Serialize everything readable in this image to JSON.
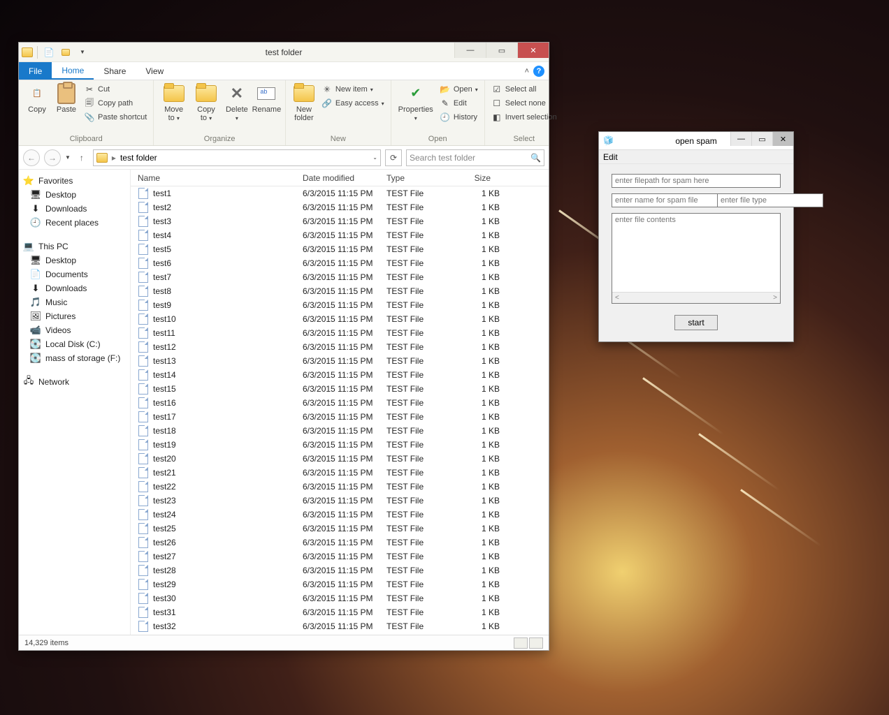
{
  "explorer": {
    "title": "test folder",
    "tabs": {
      "file": "File",
      "home": "Home",
      "share": "Share",
      "view": "View"
    },
    "ribbon": {
      "clipboard": {
        "label": "Clipboard",
        "copy": "Copy",
        "paste": "Paste",
        "cut": "Cut",
        "copy_path": "Copy path",
        "paste_shortcut": "Paste shortcut"
      },
      "organize": {
        "label": "Organize",
        "move_to": "Move to",
        "copy_to": "Copy to",
        "delete": "Delete",
        "rename": "Rename"
      },
      "new": {
        "label": "New",
        "new_folder": "New folder",
        "new_item": "New item",
        "easy_access": "Easy access"
      },
      "open": {
        "label": "Open",
        "properties": "Properties",
        "open": "Open",
        "edit": "Edit",
        "history": "History"
      },
      "select": {
        "label": "Select",
        "select_all": "Select all",
        "select_none": "Select none",
        "invert": "Invert selection"
      }
    },
    "address": {
      "path": "test folder",
      "separator": "▸"
    },
    "search_placeholder": "Search test folder",
    "columns": {
      "name": "Name",
      "date": "Date modified",
      "type": "Type",
      "size": "Size"
    },
    "sidebar": {
      "favorites": {
        "label": "Favorites",
        "items": [
          "Desktop",
          "Downloads",
          "Recent places"
        ]
      },
      "this_pc": {
        "label": "This PC",
        "items": [
          "Desktop",
          "Documents",
          "Downloads",
          "Music",
          "Pictures",
          "Videos",
          "Local Disk (C:)",
          "mass of storage (F:)"
        ]
      },
      "network": {
        "label": "Network"
      }
    },
    "files": [
      {
        "name": "test1",
        "date": "6/3/2015 11:15 PM",
        "type": "TEST File",
        "size": "1 KB"
      },
      {
        "name": "test2",
        "date": "6/3/2015 11:15 PM",
        "type": "TEST File",
        "size": "1 KB"
      },
      {
        "name": "test3",
        "date": "6/3/2015 11:15 PM",
        "type": "TEST File",
        "size": "1 KB"
      },
      {
        "name": "test4",
        "date": "6/3/2015 11:15 PM",
        "type": "TEST File",
        "size": "1 KB"
      },
      {
        "name": "test5",
        "date": "6/3/2015 11:15 PM",
        "type": "TEST File",
        "size": "1 KB"
      },
      {
        "name": "test6",
        "date": "6/3/2015 11:15 PM",
        "type": "TEST File",
        "size": "1 KB"
      },
      {
        "name": "test7",
        "date": "6/3/2015 11:15 PM",
        "type": "TEST File",
        "size": "1 KB"
      },
      {
        "name": "test8",
        "date": "6/3/2015 11:15 PM",
        "type": "TEST File",
        "size": "1 KB"
      },
      {
        "name": "test9",
        "date": "6/3/2015 11:15 PM",
        "type": "TEST File",
        "size": "1 KB"
      },
      {
        "name": "test10",
        "date": "6/3/2015 11:15 PM",
        "type": "TEST File",
        "size": "1 KB"
      },
      {
        "name": "test11",
        "date": "6/3/2015 11:15 PM",
        "type": "TEST File",
        "size": "1 KB"
      },
      {
        "name": "test12",
        "date": "6/3/2015 11:15 PM",
        "type": "TEST File",
        "size": "1 KB"
      },
      {
        "name": "test13",
        "date": "6/3/2015 11:15 PM",
        "type": "TEST File",
        "size": "1 KB"
      },
      {
        "name": "test14",
        "date": "6/3/2015 11:15 PM",
        "type": "TEST File",
        "size": "1 KB"
      },
      {
        "name": "test15",
        "date": "6/3/2015 11:15 PM",
        "type": "TEST File",
        "size": "1 KB"
      },
      {
        "name": "test16",
        "date": "6/3/2015 11:15 PM",
        "type": "TEST File",
        "size": "1 KB"
      },
      {
        "name": "test17",
        "date": "6/3/2015 11:15 PM",
        "type": "TEST File",
        "size": "1 KB"
      },
      {
        "name": "test18",
        "date": "6/3/2015 11:15 PM",
        "type": "TEST File",
        "size": "1 KB"
      },
      {
        "name": "test19",
        "date": "6/3/2015 11:15 PM",
        "type": "TEST File",
        "size": "1 KB"
      },
      {
        "name": "test20",
        "date": "6/3/2015 11:15 PM",
        "type": "TEST File",
        "size": "1 KB"
      },
      {
        "name": "test21",
        "date": "6/3/2015 11:15 PM",
        "type": "TEST File",
        "size": "1 KB"
      },
      {
        "name": "test22",
        "date": "6/3/2015 11:15 PM",
        "type": "TEST File",
        "size": "1 KB"
      },
      {
        "name": "test23",
        "date": "6/3/2015 11:15 PM",
        "type": "TEST File",
        "size": "1 KB"
      },
      {
        "name": "test24",
        "date": "6/3/2015 11:15 PM",
        "type": "TEST File",
        "size": "1 KB"
      },
      {
        "name": "test25",
        "date": "6/3/2015 11:15 PM",
        "type": "TEST File",
        "size": "1 KB"
      },
      {
        "name": "test26",
        "date": "6/3/2015 11:15 PM",
        "type": "TEST File",
        "size": "1 KB"
      },
      {
        "name": "test27",
        "date": "6/3/2015 11:15 PM",
        "type": "TEST File",
        "size": "1 KB"
      },
      {
        "name": "test28",
        "date": "6/3/2015 11:15 PM",
        "type": "TEST File",
        "size": "1 KB"
      },
      {
        "name": "test29",
        "date": "6/3/2015 11:15 PM",
        "type": "TEST File",
        "size": "1 KB"
      },
      {
        "name": "test30",
        "date": "6/3/2015 11:15 PM",
        "type": "TEST File",
        "size": "1 KB"
      },
      {
        "name": "test31",
        "date": "6/3/2015 11:15 PM",
        "type": "TEST File",
        "size": "1 KB"
      },
      {
        "name": "test32",
        "date": "6/3/2015 11:15 PM",
        "type": "TEST File",
        "size": "1 KB"
      }
    ],
    "status": "14,329 items"
  },
  "spam": {
    "title": "open spam",
    "menu_edit": "Edit",
    "filepath_placeholder": "enter filepath for spam here",
    "filename_placeholder": "enter name for spam file",
    "filetype_placeholder": "enter file type",
    "contents_placeholder": "enter file contents",
    "start": "start"
  }
}
